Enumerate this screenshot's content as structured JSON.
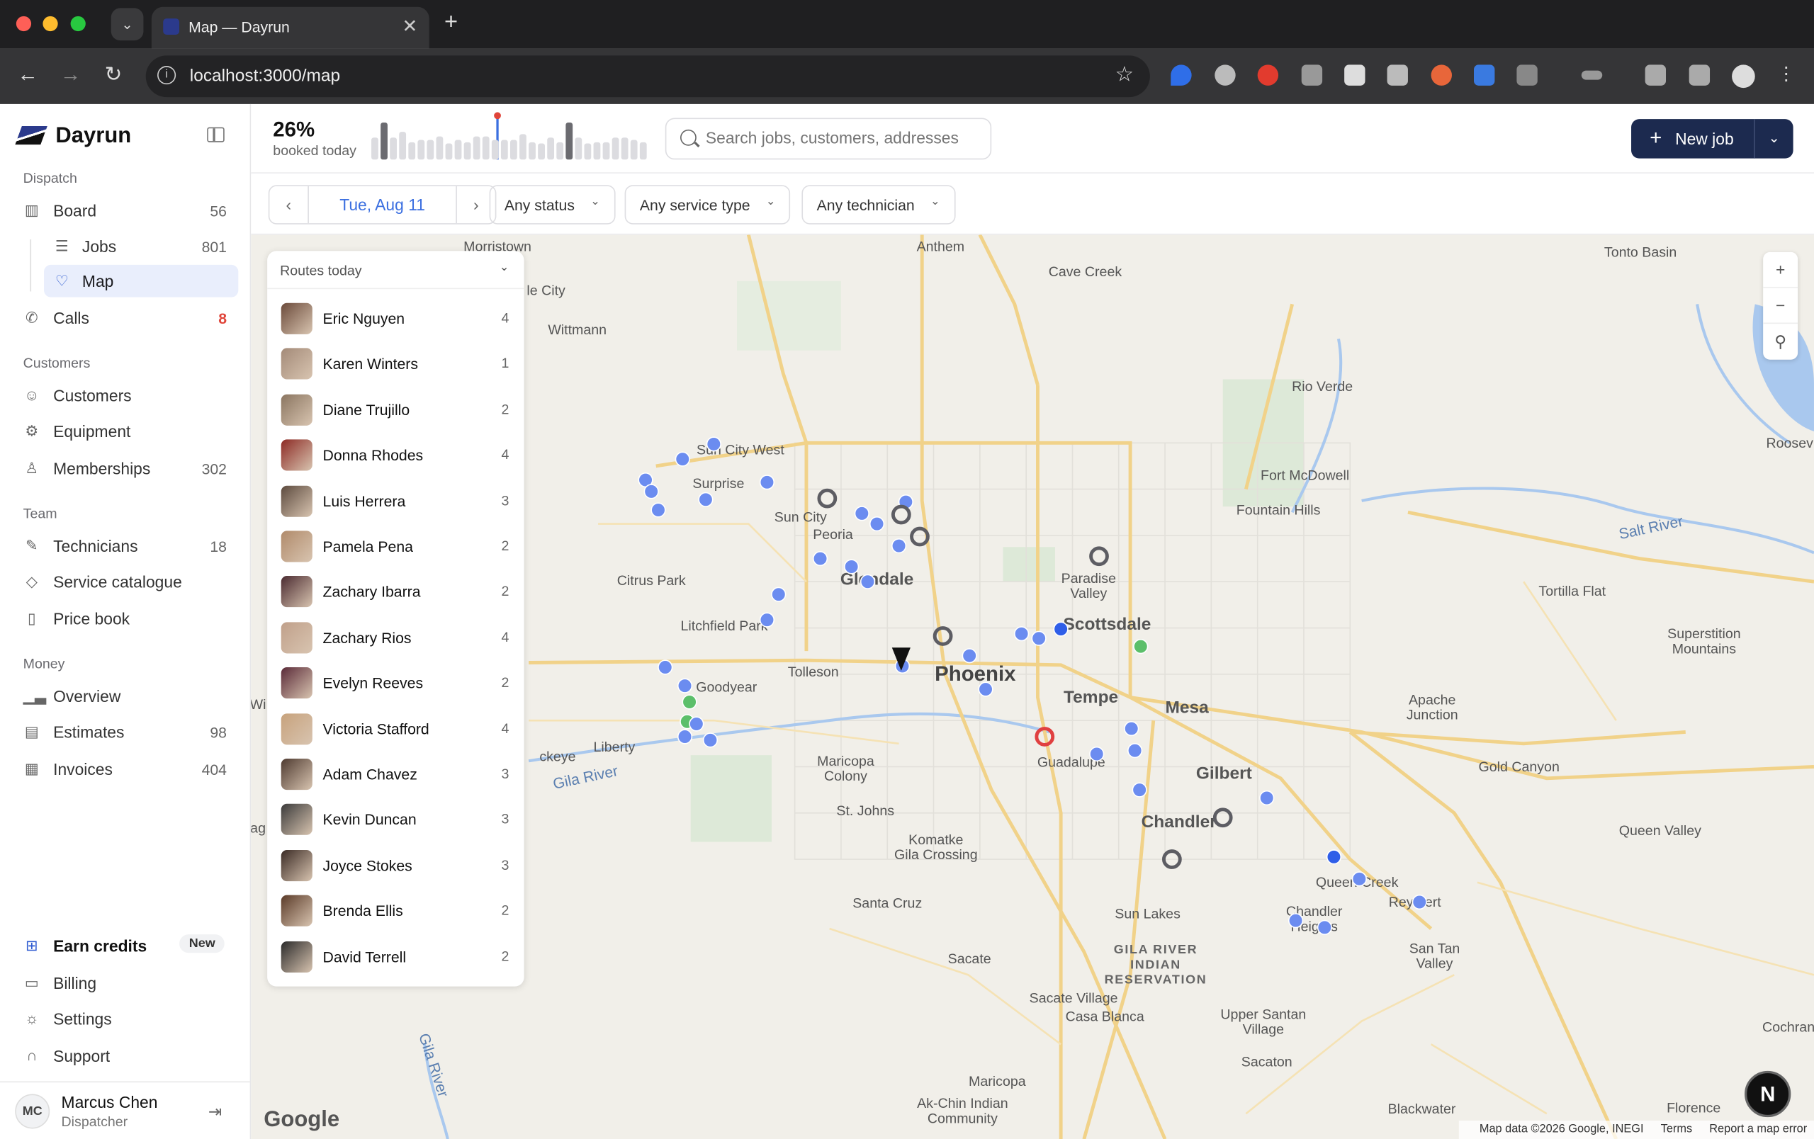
{
  "browser": {
    "tab_title": "Map — Dayrun",
    "url": "localhost:3000/map",
    "tab_close": "✕",
    "new_tab": "+"
  },
  "sidebar": {
    "brand": "Dayrun",
    "sections": {
      "dispatch": "Dispatch",
      "customers": "Customers",
      "team": "Team",
      "money": "Money"
    },
    "items": {
      "board": {
        "label": "Board",
        "count": "56"
      },
      "jobs": {
        "label": "Jobs",
        "count": "801"
      },
      "map": {
        "label": "Map"
      },
      "calls": {
        "label": "Calls",
        "count": "8"
      },
      "customers": {
        "label": "Customers"
      },
      "equipment": {
        "label": "Equipment"
      },
      "memberships": {
        "label": "Memberships",
        "count": "302"
      },
      "technicians": {
        "label": "Technicians",
        "count": "18"
      },
      "service_catalogue": {
        "label": "Service catalogue"
      },
      "price_book": {
        "label": "Price book"
      },
      "overview": {
        "label": "Overview"
      },
      "estimates": {
        "label": "Estimates",
        "count": "98"
      },
      "invoices": {
        "label": "Invoices",
        "count": "404"
      },
      "earn_credits": {
        "label": "Earn credits",
        "badge": "New"
      },
      "billing": {
        "label": "Billing"
      },
      "settings": {
        "label": "Settings"
      },
      "support": {
        "label": "Support"
      }
    },
    "user": {
      "initials": "MC",
      "name": "Marcus Chen",
      "role": "Dispatcher"
    }
  },
  "header": {
    "kpi_value": "26%",
    "kpi_label": "booked today",
    "search_placeholder": "Search jobs, customers, addresses",
    "new_job_label": "New job",
    "booking_levels": [
      0.55,
      0.95,
      0.55,
      0.7,
      0.45,
      0.5,
      0.5,
      0.6,
      0.4,
      0.5,
      0.45,
      0.6,
      0.6,
      0.5,
      0.5,
      0.5,
      0.65,
      0.45,
      0.4,
      0.55,
      0.45,
      0.95,
      0.55,
      0.4,
      0.45,
      0.45,
      0.55,
      0.55,
      0.5,
      0.45
    ]
  },
  "filters": {
    "date": "Tue, Aug 11",
    "status": "Any status",
    "service_type": "Any service type",
    "technician": "Any technician"
  },
  "routes_panel": {
    "title": "Routes today",
    "technicians": [
      {
        "name": "Eric Nguyen",
        "count": "4",
        "avatar_color": "#6b4a3a"
      },
      {
        "name": "Karen Winters",
        "count": "1",
        "avatar_color": "#a38a78"
      },
      {
        "name": "Diane Trujillo",
        "count": "2",
        "avatar_color": "#8a7560"
      },
      {
        "name": "Donna Rhodes",
        "count": "4",
        "avatar_color": "#8c2a24"
      },
      {
        "name": "Luis Herrera",
        "count": "3",
        "avatar_color": "#5c4a3e"
      },
      {
        "name": "Pamela Pena",
        "count": "2",
        "avatar_color": "#b08a6a"
      },
      {
        "name": "Zachary Ibarra",
        "count": "2",
        "avatar_color": "#4a2a30"
      },
      {
        "name": "Zachary Rios",
        "count": "4",
        "avatar_color": "#c0a08a"
      },
      {
        "name": "Evelyn Reeves",
        "count": "2",
        "avatar_color": "#5a2a38"
      },
      {
        "name": "Victoria Stafford",
        "count": "4",
        "avatar_color": "#c7a27c"
      },
      {
        "name": "Adam Chavez",
        "count": "3",
        "avatar_color": "#4e3a30"
      },
      {
        "name": "Kevin Duncan",
        "count": "3",
        "avatar_color": "#3a3a3a"
      },
      {
        "name": "Joyce Stokes",
        "count": "3",
        "avatar_color": "#3a2a24"
      },
      {
        "name": "Brenda Ellis",
        "count": "2",
        "avatar_color": "#5a3a28"
      },
      {
        "name": "David Terrell",
        "count": "2",
        "avatar_color": "#2a2a2a"
      }
    ]
  },
  "map": {
    "places": {
      "morristown": "Morristown",
      "anthem": "Anthem",
      "cave_creek": "Cave Creek",
      "tonto_basin": "Tonto Basin",
      "le_city": "le City",
      "wittmann": "Wittmann",
      "rio_verde": "Rio Verde",
      "sun_city_west": "Sun City West",
      "surprise": "Surprise",
      "sun_city": "Sun City",
      "peoria": "Peoria",
      "fort_mcdowell": "Fort McDowell",
      "fountain_hills": "Fountain Hills",
      "salt_river": "Salt River",
      "roosevelt": "Roosev",
      "citrus_park": "Citrus Park",
      "glendale": "Glendale",
      "paradise_valley": "Paradise\nValley",
      "tortilla_flat": "Tortilla Flat",
      "litchfield_park": "Litchfield Park",
      "scottsdale": "Scottsdale",
      "superstition": "Superstition\nMountains",
      "tolleson": "Tolleson",
      "phoenix": "Phoenix",
      "goodyear": "Goodyear",
      "tempe": "Tempe",
      "mesa": "Mesa",
      "apache_junction": "Apache\nJunction",
      "wi": "Wi",
      "liberty": "Liberty",
      "keye": "ckeye",
      "gila_river": "Gila River",
      "maricopa_colony": "Maricopa\nColony",
      "guadalupe": "Guadalupe",
      "gilbert": "Gilbert",
      "gold_canyon": "Gold Canyon",
      "ag": "ag",
      "st_johns": "St. Johns",
      "chandler": "Chandler",
      "komatke": "Komatke\nGila Crossing",
      "queen_valley": "Queen Valley",
      "queen_creek": "Queen Creek",
      "santa_cruz": "Santa Cruz",
      "reymert": "Reymert",
      "sun_lakes": "Sun Lakes",
      "chandler_heights": "Chandler\nHeights",
      "sacate": "Sacate",
      "gila_river_res": "GILA RIVER\nINDIAN\nRESERVATION",
      "san_tan_valley": "San Tan\nValley",
      "sacate_village": "Sacate Village",
      "casa_blanca": "Casa Blanca",
      "upper_santan": "Upper Santan\nVillage",
      "cochran": "Cochran",
      "sacaton": "Sacaton",
      "maricopa": "Maricopa",
      "ak_chin": "Ak-Chin Indian\nCommunity",
      "blackwater": "Blackwater",
      "florence": "Florence",
      "gila_river_2": "Gila River"
    },
    "zoom_in": "+",
    "zoom_out": "−",
    "attribution": "Map data ©2026 Google, INEGI",
    "terms": "Terms",
    "report": "Report a map error",
    "google_logo": "Google",
    "help_badge": "N",
    "colors": {
      "job": "#6b8cf0",
      "job_dark": "#2f5ee8",
      "done": "#5cbf6a",
      "idle_ring": "#5d5d63",
      "alert_ring": "#e04040"
    }
  }
}
